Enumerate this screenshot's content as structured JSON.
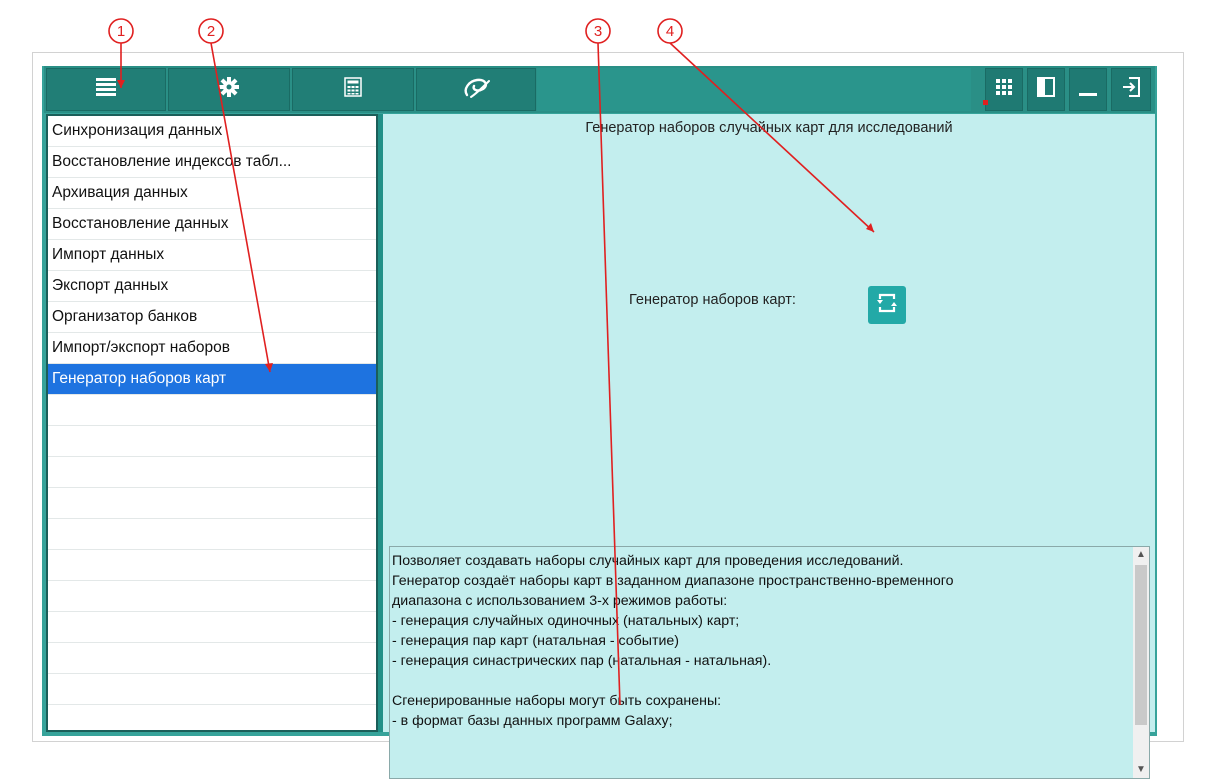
{
  "callouts": [
    "1",
    "2",
    "3",
    "4"
  ],
  "toolbar": {
    "left_buttons": [
      {
        "icon": "menu-lines-icon"
      },
      {
        "icon": "gear-icon"
      },
      {
        "icon": "calculator-icon"
      },
      {
        "icon": "galaxy-logo-icon"
      }
    ],
    "right_buttons": [
      {
        "icon": "grid-icon"
      },
      {
        "icon": "panel-toggle-icon"
      },
      {
        "icon": "minimize-icon"
      },
      {
        "icon": "exit-icon"
      }
    ]
  },
  "sidebar": {
    "items": [
      {
        "label": "Синхронизация данных"
      },
      {
        "label": "Восстановление индексов табл..."
      },
      {
        "label": "Архивация данных"
      },
      {
        "label": "Восстановление данных"
      },
      {
        "label": "Импорт данных"
      },
      {
        "label": "Экспорт данных"
      },
      {
        "label": "Организатор банков"
      },
      {
        "label": "Импорт/экспорт наборов"
      },
      {
        "label": "Генератор наборов карт",
        "selected": true
      }
    ]
  },
  "main": {
    "title": "Генератор наборов случайных карт для исследований",
    "generator_label": "Генератор наборов карт:",
    "generator_icon": "refresh-cycle-icon",
    "description": [
      "Позволяет создавать наборы случайных карт для проведения исследований.",
      "Генератор создаёт наборы карт в заданном диапазоне пространственно-временного",
      "диапазона с использованием 3-х режимов работы:",
      "- генерация случайных одиночных (натальных) карт;",
      "- генерация пар карт (натальная - событие)",
      "- генерация синастрических пар (натальная - натальная).",
      "",
      "Сгенерированные наборы могут быть сохранены:",
      "- в формат базы данных программ Galaxy;"
    ]
  },
  "colors": {
    "toolbar": "#2a8f86",
    "panel_bg": "#c3eeee",
    "selected": "#1e73e0",
    "callout": "#e02020"
  }
}
